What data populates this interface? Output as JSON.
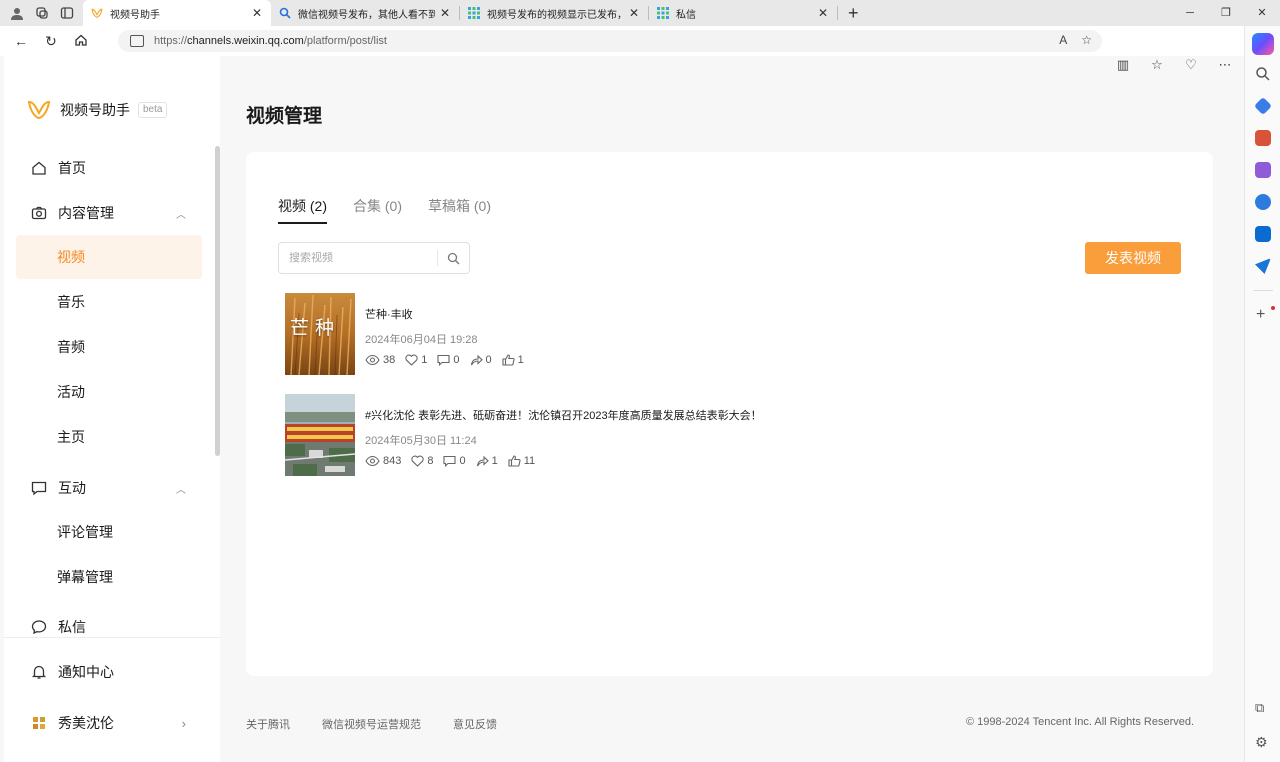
{
  "browser": {
    "tabs": [
      {
        "title": "视频号助手",
        "active": true
      },
      {
        "title": "微信视频号发布，其他人看不到",
        "active": false
      },
      {
        "title": "视频号发布的视频显示已发布，",
        "active": false
      },
      {
        "title": "私信",
        "active": false
      }
    ],
    "url_prefix": "https://",
    "url_host": "channels.weixin.qq.com",
    "url_path": "/platform/post/list"
  },
  "app": {
    "name": "视频号助手",
    "badge": "beta",
    "brand_color": "#f58a1f"
  },
  "nav": {
    "home": "首页",
    "content": "内容管理",
    "content_sub": [
      "视频",
      "音乐",
      "音频",
      "活动",
      "主页"
    ],
    "interact": "互动",
    "interact_sub": [
      "评论管理",
      "弹幕管理"
    ],
    "messages": "私信",
    "notifications": "通知中心",
    "account": "秀美沈伦"
  },
  "main": {
    "title": "视频管理",
    "tabs": [
      "视频 (2)",
      "合集 (0)",
      "草稿箱 (0)"
    ],
    "search_placeholder": "搜索视频",
    "publish_label": "发表视频",
    "posts": [
      {
        "title": "芒种·丰收",
        "thumb_text": "芒 种",
        "time": "2024年06月04日 19:28",
        "views": "38",
        "likes": "1",
        "comments": "0",
        "shares": "0",
        "thumbs": "1"
      },
      {
        "title": "#兴化沈伦 表彰先进、砥砺奋进！沈伦镇召开2023年度高质量发展总结表彰大会！",
        "time": "2024年05月30日 11:24",
        "views": "843",
        "likes": "8",
        "comments": "0",
        "shares": "1",
        "thumbs": "11"
      }
    ]
  },
  "footer": {
    "links": [
      "关于腾讯",
      "微信视频号运营规范",
      "意见反馈"
    ],
    "copyright": "© 1998-2024 Tencent Inc. All Rights Reserved."
  }
}
